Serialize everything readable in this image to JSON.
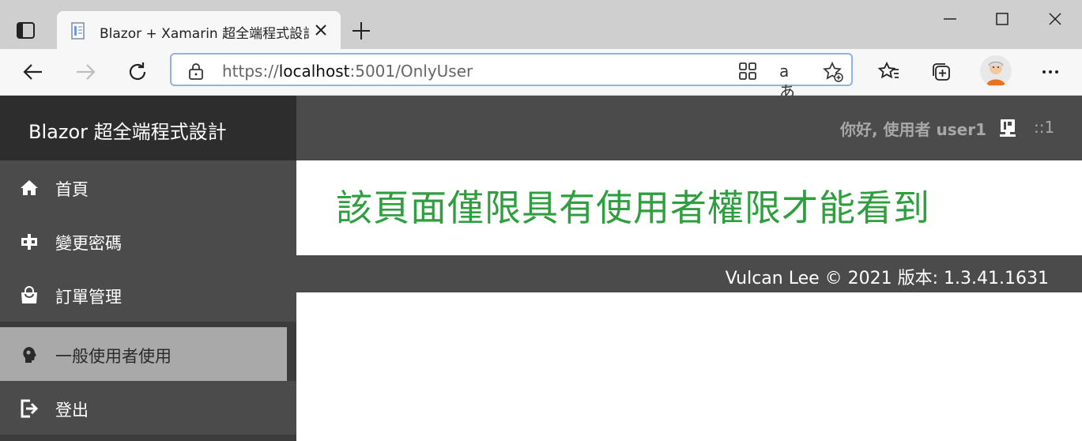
{
  "browser": {
    "tab": {
      "title": "Blazor + Xamarin 超全端程式設計",
      "favicon": "page-icon",
      "close_icon": "close-icon"
    },
    "new_tab_icon": "plus-icon",
    "window_controls": [
      "minimize-icon",
      "maximize-icon",
      "close-icon"
    ],
    "address": {
      "scheme": "https://",
      "host": "localhost",
      "rest": ":5001/OnlyUser"
    },
    "toolbar_icons": [
      "back-icon",
      "forward-icon",
      "refresh-icon",
      "lock-icon",
      "apps-icon",
      "read-aloud-icon",
      "favorite-add-icon",
      "favorites-icon",
      "collections-icon",
      "profile-avatar",
      "more-icon"
    ]
  },
  "app": {
    "brand": "Blazor 超全端程式設計",
    "nav": [
      {
        "label": "首頁",
        "icon": "home-icon",
        "active": false
      },
      {
        "label": "變更密碼",
        "icon": "key-icon",
        "active": false
      },
      {
        "label": "訂單管理",
        "icon": "shopping-bag-icon",
        "active": false
      },
      {
        "label": "一般使用者使用",
        "icon": "person-icon",
        "active": true
      },
      {
        "label": "登出",
        "icon": "sign-out-icon",
        "active": false
      }
    ],
    "header": {
      "greeting": "你好, 使用者 user1",
      "user_icon": "user-badge-icon",
      "ip": "::1"
    },
    "main": {
      "heading": "該頁面僅限具有使用者權限才能看到"
    },
    "footer": {
      "text": "Vulcan Lee  © 2021  版本: 1.3.41.1631"
    }
  },
  "colors": {
    "sidebar": "#4b4b4b",
    "brand_bg": "#2d2d2d",
    "active_item": "#a9a9a9",
    "heading": "#2e9e3e"
  }
}
